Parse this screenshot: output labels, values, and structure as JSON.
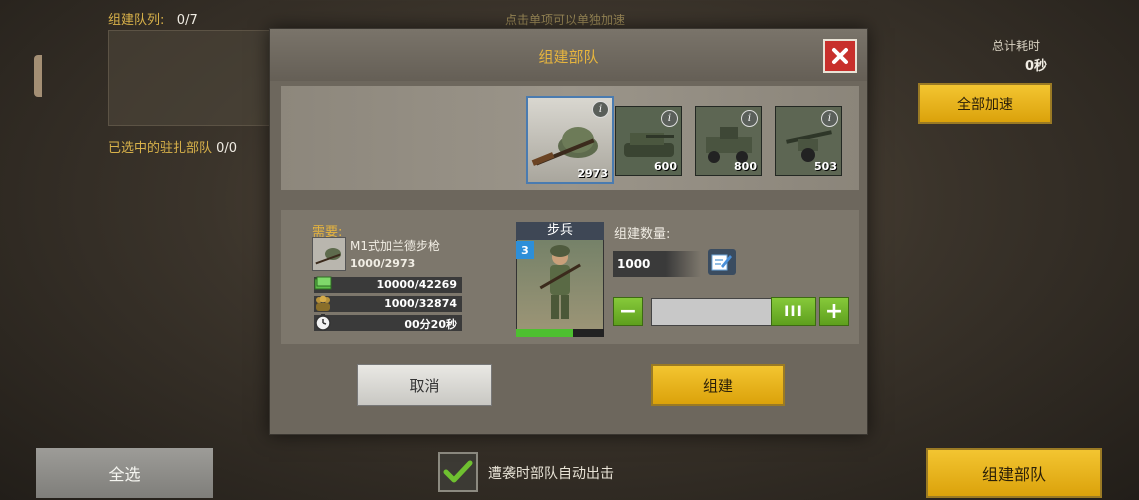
{
  "background": {
    "queue_label": "组建队列:",
    "queue_value": "0/7",
    "hint": "点击单项可以单独加速",
    "selected_label": "已选中的驻扎部队",
    "selected_value": "0/0",
    "total_time_label": "总计耗时",
    "total_time_value": "0秒",
    "speedup_all_label": "全部加速",
    "select_all_label": "全选",
    "auto_deploy_label": "遭袭时部队自动出击",
    "auto_deploy_checked": true,
    "build_troops_label": "组建部队"
  },
  "modal": {
    "title": "组建部队",
    "units": [
      {
        "name": "infantry",
        "count": "2973",
        "selected": true
      },
      {
        "name": "light-tank",
        "count": "600"
      },
      {
        "name": "artillery-truck",
        "count": "800"
      },
      {
        "name": "anti-tank-gun",
        "count": "503"
      }
    ],
    "requirements": {
      "label": "需要:",
      "weapon_name": "M1式加兰德步枪",
      "weapon_count": "1000/2973",
      "resources": [
        {
          "icon": "cash-icon",
          "value": "10000/42269"
        },
        {
          "icon": "manpower-icon",
          "value": "1000/32874"
        },
        {
          "icon": "clock-icon",
          "value": "00分20秒"
        }
      ]
    },
    "unit_detail": {
      "name": "步兵",
      "level": "3",
      "progress": 0.65
    },
    "quantity": {
      "label": "组建数量:",
      "value": "1000",
      "slider_fraction": 1.0
    },
    "cancel_label": "取消",
    "build_label": "组建"
  },
  "colors": {
    "accent_gold": "#e7b53e",
    "button_gold": "#f3c531",
    "close_red": "#c8302c",
    "green": "#6fb22a"
  }
}
